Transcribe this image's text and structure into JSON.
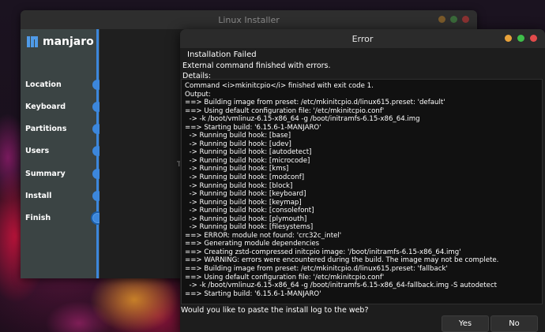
{
  "installer": {
    "title": "Linux Installer",
    "logo_text": "manjaro",
    "steps": [
      {
        "label": "Location"
      },
      {
        "label": "Keyboard"
      },
      {
        "label": "Partitions"
      },
      {
        "label": "Users"
      },
      {
        "label": "Summary"
      },
      {
        "label": "Install"
      },
      {
        "label": "Finish"
      }
    ],
    "current_step": "Finish",
    "peek_text": "T"
  },
  "dialog": {
    "title": "Error",
    "heading": "Installation Failed",
    "summary": "External command finished with errors.",
    "details_label": "Details:",
    "log_lines": [
      "Command <i>mkinitcpio</i> finished with exit code 1.",
      "Output:",
      "==> Building image from preset: /etc/mkinitcpio.d/linux615.preset: 'default'",
      "==> Using default configuration file: '/etc/mkinitcpio.conf'",
      "  -> -k /boot/vmlinuz-6.15-x86_64 -g /boot/initramfs-6.15-x86_64.img",
      "==> Starting build: '6.15.6-1-MANJARO'",
      "  -> Running build hook: [base]",
      "  -> Running build hook: [udev]",
      "  -> Running build hook: [autodetect]",
      "  -> Running build hook: [microcode]",
      "  -> Running build hook: [kms]",
      "  -> Running build hook: [modconf]",
      "  -> Running build hook: [block]",
      "  -> Running build hook: [keyboard]",
      "  -> Running build hook: [keymap]",
      "  -> Running build hook: [consolefont]",
      "  -> Running build hook: [plymouth]",
      "  -> Running build hook: [filesystems]",
      "==> ERROR: module not found: 'crc32c_intel'",
      "==> Generating module dependencies",
      "==> Creating zstd-compressed initcpio image: '/boot/initramfs-6.15-x86_64.img'",
      "==> WARNING: errors were encountered during the build. The image may not be complete.",
      "==> Building image from preset: /etc/mkinitcpio.d/linux615.preset: 'fallback'",
      "==> Using default configuration file: '/etc/mkinitcpio.conf'",
      "  -> -k /boot/vmlinuz-6.15-x86_64 -g /boot/initramfs-6.15-x86_64-fallback.img -S autodetect",
      "==> Starting build: '6.15.6-1-MANJARO'"
    ],
    "prompt": "Would you like to paste the install log to the web?",
    "yes_label": "Yes",
    "no_label": "No"
  },
  "colors": {
    "accent": "#3c87dc",
    "window_close": "#e24b4b",
    "window_maximize": "#3fbf4a",
    "window_minimize": "#e8a23a"
  }
}
